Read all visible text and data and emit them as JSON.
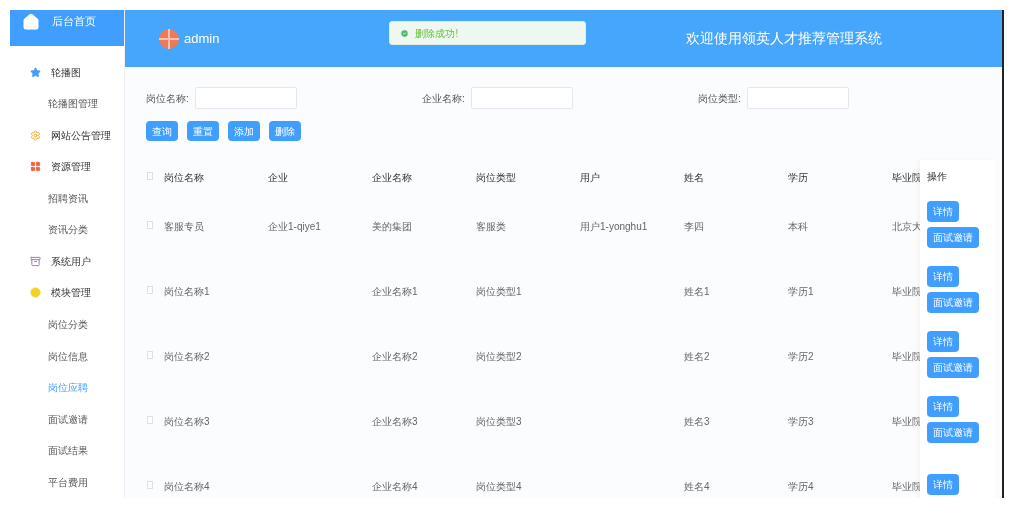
{
  "sidebar": {
    "home": {
      "label": "后台首页"
    },
    "items": [
      {
        "label": "轮播图",
        "selected": false,
        "children": [
          {
            "label": "轮播图管理",
            "selected": false
          }
        ]
      },
      {
        "label": "网站公告管理",
        "selected": false
      },
      {
        "label": "资源管理",
        "selected": false,
        "children": [
          {
            "label": "招聘资讯",
            "selected": false
          },
          {
            "label": "资讯分类",
            "selected": false
          }
        ]
      },
      {
        "label": "系统用户",
        "selected": false
      },
      {
        "label": "模块管理",
        "selected": false,
        "children": [
          {
            "label": "岗位分类",
            "selected": false
          },
          {
            "label": "岗位信息",
            "selected": false
          },
          {
            "label": "岗位应聘",
            "selected": true
          },
          {
            "label": "面试邀请",
            "selected": false
          },
          {
            "label": "面试结果",
            "selected": false
          },
          {
            "label": "平台费用",
            "selected": false
          }
        ]
      }
    ]
  },
  "header": {
    "user": "admin",
    "toast": "删除成功!",
    "title": "欢迎使用领英人才推荐管理系统"
  },
  "search": {
    "fields": [
      {
        "label": "岗位名称:"
      },
      {
        "label": "企业名称:"
      },
      {
        "label": "岗位类型:"
      }
    ],
    "buttons": [
      "查询",
      "重置",
      "添加",
      "删除"
    ]
  },
  "table": {
    "all_checked": false,
    "columns": [
      "岗位名称",
      "企业",
      "企业名称",
      "岗位类型",
      "用户",
      "姓名",
      "学历",
      "毕业院"
    ],
    "actions_header": "操作",
    "rows": [
      {
        "checked": false,
        "cells": [
          "客服专员",
          "企业1-qiye1",
          "美的集团",
          "客服类",
          "用户1-yonghu1",
          "李四",
          "本科",
          "北京大"
        ],
        "actions": [
          "详情",
          "面试邀请"
        ]
      },
      {
        "checked": false,
        "cells": [
          "岗位名称1",
          "",
          "企业名称1",
          "岗位类型1",
          "",
          "姓名1",
          "学历1",
          "毕业院"
        ],
        "actions": [
          "详情",
          "面试邀请"
        ]
      },
      {
        "checked": false,
        "cells": [
          "岗位名称2",
          "",
          "企业名称2",
          "岗位类型2",
          "",
          "姓名2",
          "学历2",
          "毕业院"
        ],
        "actions": [
          "详情",
          "面试邀请"
        ]
      },
      {
        "checked": false,
        "cells": [
          "岗位名称3",
          "",
          "企业名称3",
          "岗位类型3",
          "",
          "姓名3",
          "学历3",
          "毕业院"
        ],
        "actions": [
          "详情",
          "面试邀请"
        ]
      },
      {
        "checked": false,
        "cells": [
          "岗位名称4",
          "",
          "企业名称4",
          "岗位类型4",
          "",
          "姓名4",
          "学历4",
          "毕业院"
        ],
        "actions": [
          "详情"
        ]
      }
    ]
  }
}
